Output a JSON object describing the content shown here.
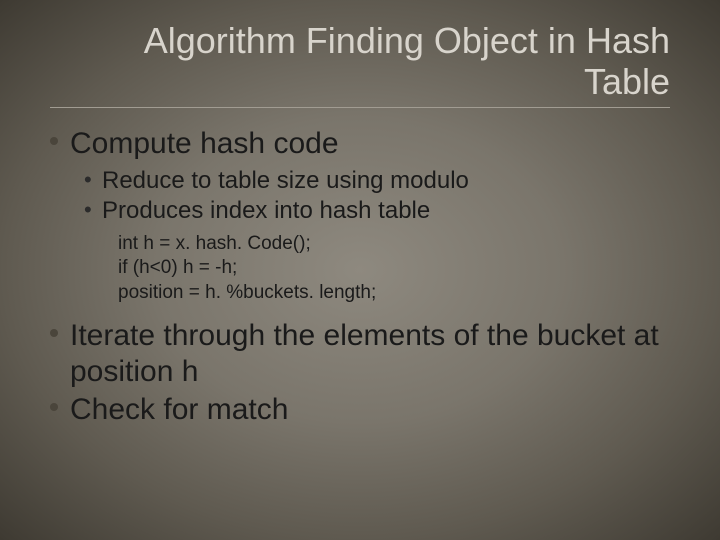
{
  "title": "Algorithm Finding Object in Hash Table",
  "items": [
    {
      "text": "Compute hash code",
      "sub": [
        "Reduce to table size using modulo",
        "Produces index into hash table"
      ],
      "code": [
        "int h = x. hash. Code();",
        "if (h<0) h = -h;",
        "position = h. %buckets. length;"
      ]
    },
    {
      "text": "Iterate through the elements of the bucket at position h"
    },
    {
      "text": "Check for match"
    }
  ]
}
